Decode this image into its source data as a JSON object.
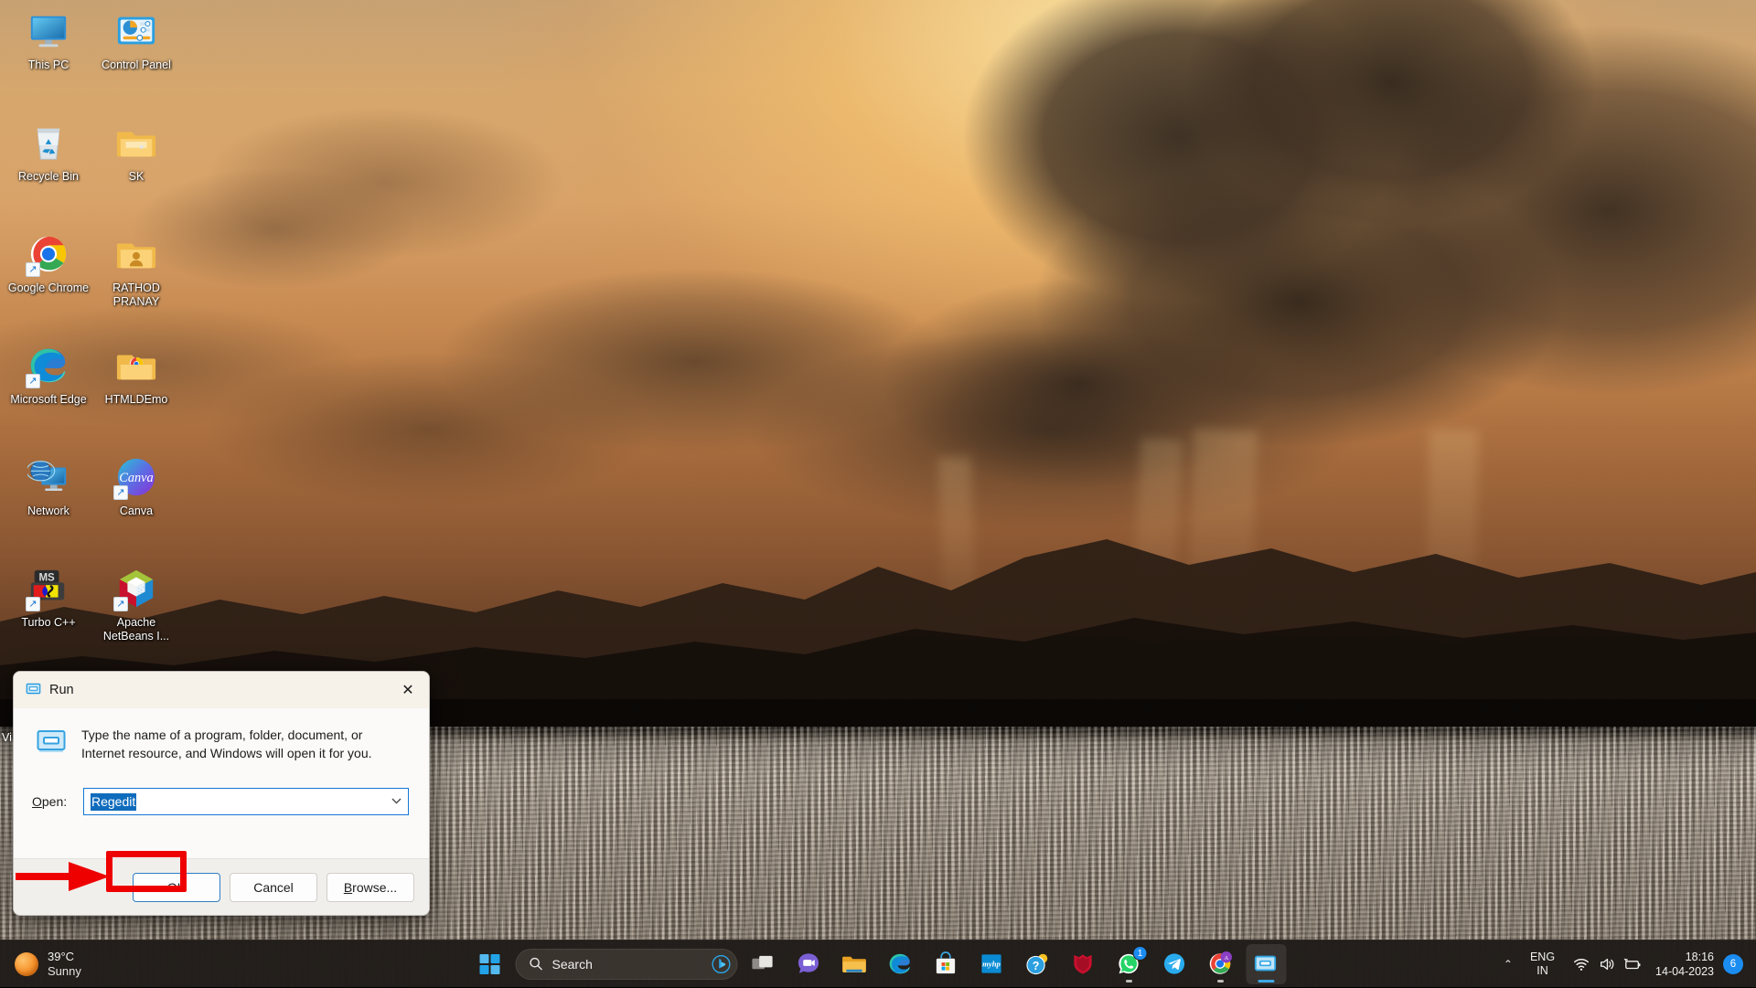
{
  "desktop": {
    "icons": [
      {
        "name": "This PC",
        "icon": "monitor-icon",
        "shortcut": false
      },
      {
        "name": "Control Panel",
        "icon": "control-panel-icon",
        "shortcut": false
      },
      {
        "name": "Recycle Bin",
        "icon": "recycle-bin-icon",
        "shortcut": false
      },
      {
        "name": "SK",
        "icon": "folder-icon",
        "shortcut": false
      },
      {
        "name": "Google Chrome",
        "icon": "chrome-icon",
        "shortcut": true
      },
      {
        "name": "RATHOD PRANAY",
        "icon": "user-folder-icon",
        "shortcut": false
      },
      {
        "name": "Microsoft Edge",
        "icon": "edge-icon",
        "shortcut": true
      },
      {
        "name": "HTMLDEmo",
        "icon": "chrome-folder-icon",
        "shortcut": false
      },
      {
        "name": "Network",
        "icon": "network-icon",
        "shortcut": false
      },
      {
        "name": "Canva",
        "icon": "canva-icon",
        "shortcut": true
      },
      {
        "name": "Turbo C++",
        "icon": "turbo-cpp-icon",
        "shortcut": true
      },
      {
        "name": "Apache NetBeans I...",
        "icon": "netbeans-icon",
        "shortcut": true
      }
    ],
    "partially_hidden_label": "Vi"
  },
  "run_dialog": {
    "title": "Run",
    "close_label": "✕",
    "description": "Type the name of a program, folder, document, or Internet resource, and Windows will open it for you.",
    "open_label_prefix": "O",
    "open_label_rest": "pen:",
    "input_value": "Regedit",
    "chevron": "⌄",
    "buttons": {
      "ok": "OK",
      "cancel": "Cancel",
      "browse_prefix": "B",
      "browse_rest": "rowse..."
    },
    "annotation": {
      "highlight_color": "#ee0000",
      "highlighted_button": "OK"
    }
  },
  "taskbar": {
    "weather": {
      "temperature": "39°C",
      "condition": "Sunny"
    },
    "start_label": "Start",
    "search": {
      "placeholder": "Search",
      "icon": "search-icon",
      "copilot_icon": "bing-chat-icon"
    },
    "apps": [
      {
        "name": "Task View",
        "icon": "task-view-icon",
        "state": "idle",
        "badge": ""
      },
      {
        "name": "Microsoft Teams",
        "icon": "teams-chat-icon",
        "state": "idle",
        "badge": ""
      },
      {
        "name": "File Explorer",
        "icon": "file-explorer-icon",
        "state": "idle",
        "badge": ""
      },
      {
        "name": "Microsoft Edge",
        "icon": "edge-icon",
        "state": "idle",
        "badge": ""
      },
      {
        "name": "Microsoft Store",
        "icon": "microsoft-store-icon",
        "state": "idle",
        "badge": ""
      },
      {
        "name": "myHP",
        "icon": "myhp-icon",
        "state": "idle",
        "badge": ""
      },
      {
        "name": "Help",
        "icon": "get-help-icon",
        "state": "idle",
        "badge": ""
      },
      {
        "name": "McAfee",
        "icon": "mcafee-icon",
        "state": "idle",
        "badge": ""
      },
      {
        "name": "WhatsApp",
        "icon": "whatsapp-icon",
        "state": "running",
        "badge": "1"
      },
      {
        "name": "Telegram",
        "icon": "telegram-icon",
        "state": "idle",
        "badge": ""
      },
      {
        "name": "Google Chrome",
        "icon": "chrome-icon",
        "state": "running",
        "badge": ""
      },
      {
        "name": "Run",
        "icon": "run-icon",
        "state": "active",
        "badge": ""
      }
    ],
    "tray": {
      "chevron": "⌃",
      "language_line1": "ENG",
      "language_line2": "IN",
      "icons": [
        "wifi-icon",
        "volume-icon",
        "battery-icon"
      ],
      "time": "18:16",
      "date": "14-04-2023",
      "notification_count": "6"
    }
  },
  "colors": {
    "accent": "#1b8cf0",
    "taskbar_bg": "#201c19",
    "dialog_bg": "#fbfaf9",
    "annotation_red": "#ee0000",
    "selection_blue": "#0f6cbd"
  }
}
